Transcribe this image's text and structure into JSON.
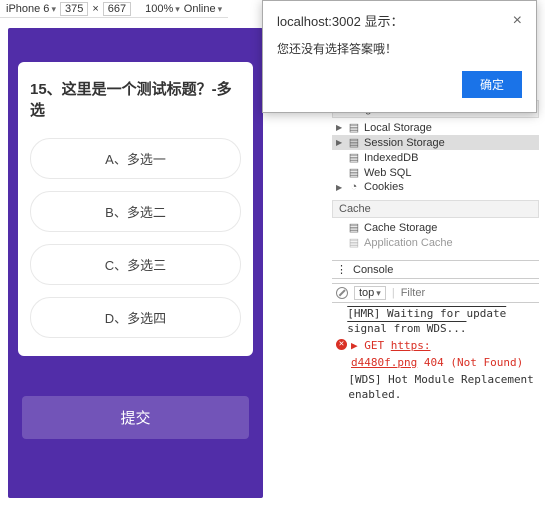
{
  "toolbar": {
    "device": "iPhone 6",
    "width": "375",
    "height": "667",
    "zoom": "100%",
    "network": "Online"
  },
  "alert": {
    "title": "localhost:3002 显示：",
    "message": "您还没有选择答案哦！",
    "ok": "确定"
  },
  "quiz": {
    "question": "15、这里是一个测试标题？-多选",
    "options": [
      "A、多选一",
      "B、多选二",
      "C、多选三",
      "D、多选四"
    ],
    "submit": "提交"
  },
  "storage": {
    "heading": "Storage",
    "items": [
      "Local Storage",
      "Session Storage",
      "IndexedDB",
      "Web SQL",
      "Cookies"
    ]
  },
  "cache": {
    "heading": "Cache",
    "items": [
      "Cache Storage",
      "Application Cache"
    ]
  },
  "console": {
    "tab": "Console",
    "scope": "top",
    "filter_placeholder": "Filter",
    "logs": {
      "hmr": "[HMR] Waiting for update signal from WDS...",
      "get": "GET",
      "url1": "https:",
      "url2": "d4480f.png",
      "status": "404 (Not Found)",
      "wds": "[WDS] Hot Module Replacement enabled."
    }
  }
}
